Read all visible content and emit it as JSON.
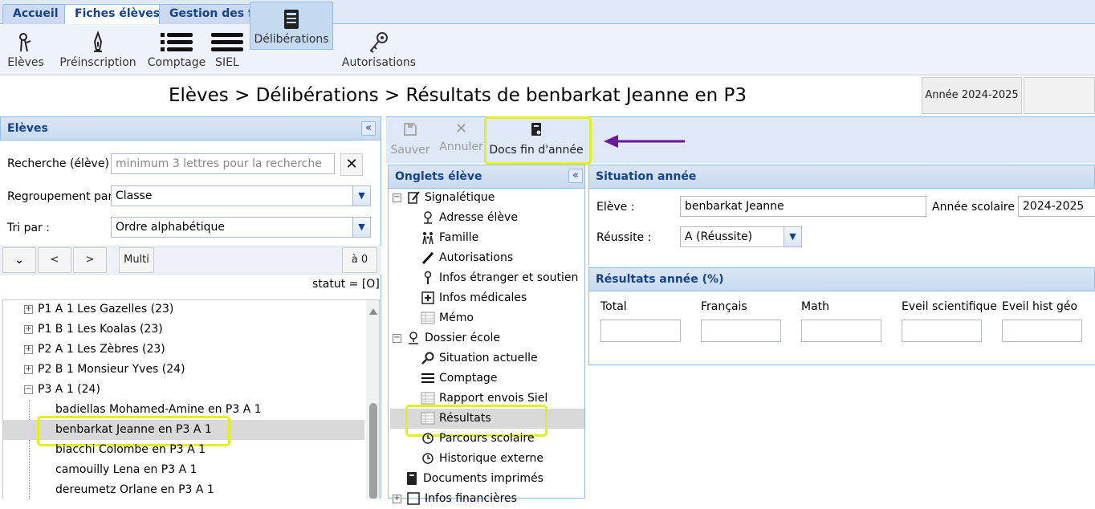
{
  "tabs": [
    "Accueil",
    "Fiches élèves",
    "Gestion des frais"
  ],
  "toolbar": [
    "Elèves",
    "Préinscription",
    "Comptage",
    "SIEL",
    "Délibérations",
    "Autorisations"
  ],
  "breadcrumb": "Elèves > Délibérations > Résultats de benbarkat Jeanne en P3",
  "year_button": "Année 2024-2025",
  "left": {
    "title": "Elèves",
    "search_label": "Recherche (élève) :",
    "search_placeholder": "minimum 3 lettres pour la recherche",
    "group_label": "Regroupement par :",
    "group_value": "Classe",
    "sort_label": "Tri par :",
    "sort_value": "Ordre alphabétique",
    "nav_prev": "<",
    "nav_next": ">",
    "multi": "Multi",
    "zero": "à 0",
    "statut": "statut = [O]",
    "tree": [
      "P1 A 1 Les Gazelles (23)",
      "P1 B 1 Les Koalas (23)",
      "P2 A 1 Les Zèbres (23)",
      "P2 B 1 Monsieur Yves (24)",
      "P3 A 1 (24)",
      "badiellas Mohamed-Amine en P3 A 1",
      "benbarkat Jeanne en P3 A 1",
      "biacchi Colombe en P3 A 1",
      "camouilly Lena en P3 A 1",
      "dereumetz Orlane en P3 A 1"
    ]
  },
  "actions": {
    "save": "Sauver",
    "cancel": "Annuler",
    "docs": "Docs fin d'année"
  },
  "onglets": {
    "title": "Onglets élève",
    "items": [
      "Signalétique",
      "Adresse élève",
      "Famille",
      "Autorisations",
      "Infos étranger et soutien",
      "Infos médicales",
      "Mémo",
      "Dossier école",
      "Situation actuelle",
      "Comptage",
      "Rapport envois Siel",
      "Résultats",
      "Parcours scolaire",
      "Historique externe",
      "Documents imprimés",
      "Infos financières"
    ]
  },
  "situation": {
    "title": "Situation année",
    "eleve_label": "Elève :",
    "eleve_value": "benbarkat Jeanne",
    "annee_label": "Année scolaire :",
    "annee_value": "2024-2025",
    "reussite_label": "Réussite :",
    "reussite_value": "A (Réussite)"
  },
  "resultats": {
    "title": "Résultats année (%)",
    "columns": [
      "Total",
      "Français",
      "Math",
      "Eveil scientifique",
      "Eveil hist géo"
    ]
  },
  "colors": {
    "accent": "#15428b",
    "highlight": "#e3f01c",
    "arrow": "#6a1b9a"
  }
}
